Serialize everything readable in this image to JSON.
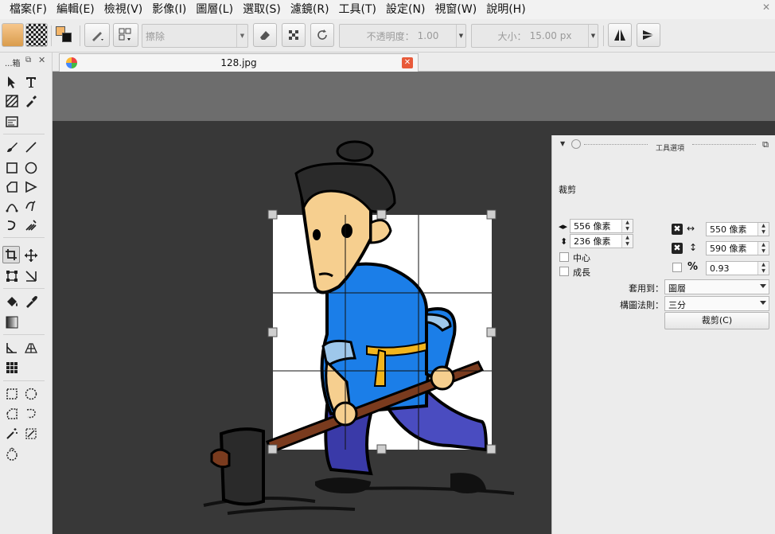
{
  "menu": [
    "檔案(F)",
    "編輯(E)",
    "檢視(V)",
    "影像(I)",
    "圖層(L)",
    "選取(S)",
    "濾鏡(R)",
    "工具(T)",
    "設定(N)",
    "視窗(W)",
    "說明(H)"
  ],
  "options_bar": {
    "mode_label": "擦除",
    "opacity_label": "不透明度：",
    "opacity_value": "1.00",
    "size_label": "大小：",
    "size_value": "15.00 px"
  },
  "toolbox": {
    "header": "...箱"
  },
  "document": {
    "tab_title": "128.jpg"
  },
  "tool_options": {
    "title": "工具選項",
    "section": "裁剪",
    "width_value": "556 像素",
    "height_value": "236 像素",
    "center_label": "中心",
    "grow_label": "成長",
    "right_width_value": "550 像素",
    "right_height_value": "590 像素",
    "ratio_symbol": "%",
    "ratio_value": "0.93",
    "apply_to_label": "套用到：",
    "apply_to_value": "圖層",
    "composition_label": "構圖法則：",
    "composition_value": "三分",
    "crop_button": "裁剪(C)"
  }
}
